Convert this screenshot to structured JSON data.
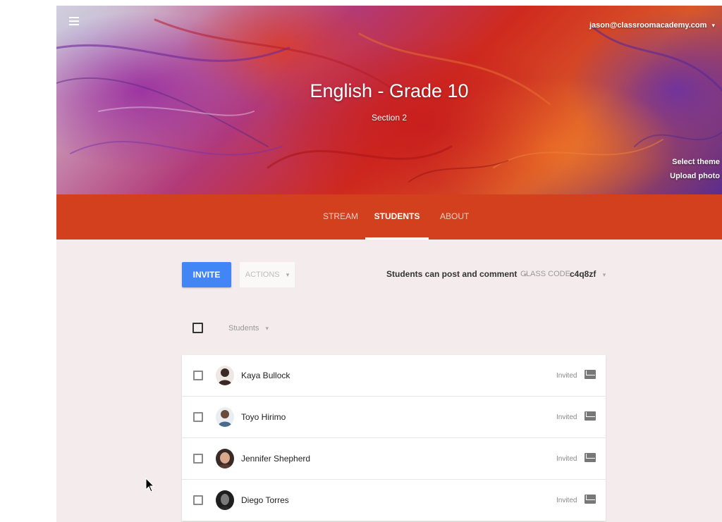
{
  "header": {
    "account_email": "jason@classroomacademy.com",
    "account_caret": "▾",
    "course_title": "English - Grade 10",
    "section": "Section 2",
    "select_theme": "Select theme",
    "upload_photo": "Upload photo"
  },
  "tabs": [
    {
      "label": "STREAM"
    },
    {
      "label": "STUDENTS",
      "active": true
    },
    {
      "label": "ABOUT"
    }
  ],
  "toolbar": {
    "invite_label": "INVITE",
    "actions_label": "ACTIONS",
    "actions_caret": "▾",
    "permission_label": "Students can post and comment",
    "permission_caret": "▾",
    "class_code_label": "CLASS CODE",
    "class_code_value": "c4q8zf",
    "class_code_caret": "▾"
  },
  "list_header": {
    "sort_label": "Students",
    "sort_caret": "▾"
  },
  "students": [
    {
      "name": "Kaya Bullock",
      "status": "Invited",
      "avatar_color": "#3a2a24"
    },
    {
      "name": "Toyo Hirimo",
      "status": "Invited",
      "avatar_color": "#4a6a8c"
    },
    {
      "name": "Jennifer Shepherd",
      "status": "Invited",
      "avatar_color": "#5a3a30"
    },
    {
      "name": "Diego Torres",
      "status": "Invited",
      "avatar_color": "#2a2a2a"
    }
  ],
  "colors": {
    "tab_bar": "#d2401e",
    "invite_button": "#4285f4",
    "page_background": "#f4ecec"
  },
  "icons": {
    "menu": "hamburger-menu-icon",
    "mail": "envelope-icon",
    "cursor": "mouse-pointer-icon"
  }
}
